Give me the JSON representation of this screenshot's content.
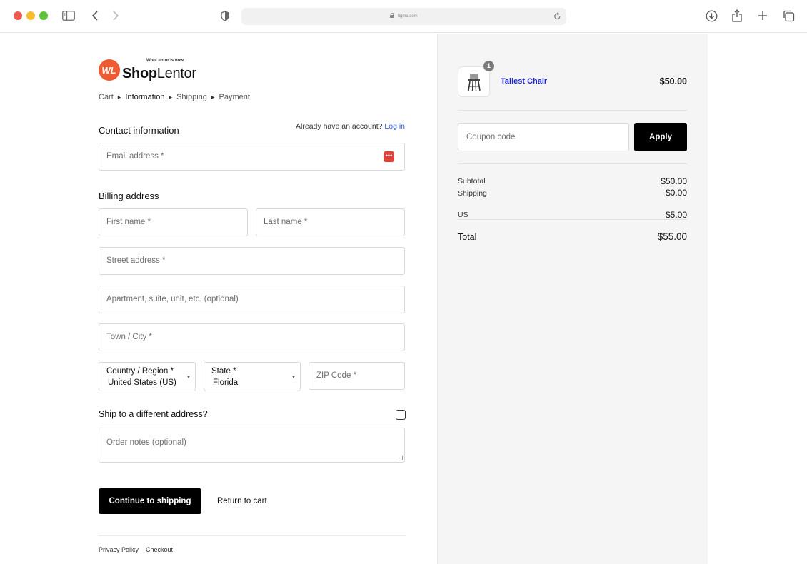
{
  "browser": {
    "url": "figma.com",
    "icons": [
      "sidebar-icon",
      "back-icon",
      "forward-icon",
      "shield-icon",
      "lock-icon",
      "reload-icon",
      "download-icon",
      "share-icon",
      "new-tab-icon",
      "tabs-overview-icon"
    ]
  },
  "brand": {
    "tagline": "WooLentor is now",
    "name_bold": "Shop",
    "name_regular": "Lentor",
    "mark_text": "WL",
    "mark_color": "#ee5a31"
  },
  "breadcrumb": [
    "Cart",
    "Information",
    "Shipping",
    "Payment"
  ],
  "contact": {
    "title": "Contact information",
    "account_prompt": "Already have an account?",
    "login_link": "Log in",
    "email_placeholder": "Email address *"
  },
  "billing": {
    "title": "Billing address",
    "first_name": "First name *",
    "last_name": "Last name *",
    "street": "Street address *",
    "apartment": "Apartment, suite, unit, etc. (optional)",
    "city": "Town / City *",
    "country_label": "Country / Region *",
    "country_value": "United States (US)",
    "state_label": "State *",
    "state_value": "Florida",
    "zip": "ZIP Code *"
  },
  "ship_different": {
    "label": "Ship to a different address?",
    "checked": false
  },
  "order_notes": "Order notes (optional)",
  "actions": {
    "continue": "Continue to shipping",
    "return": "Return to cart"
  },
  "footer": [
    "Privacy Policy",
    "Checkout"
  ],
  "order": {
    "item": {
      "name": "Tallest Chair",
      "price": "$50.00",
      "quantity": "1"
    },
    "coupon_placeholder": "Coupon code",
    "apply": "Apply",
    "subtotal_label": "Subtotal",
    "subtotal_value": "$50.00",
    "shipping_label": "Shipping",
    "shipping_value": "$0.00",
    "tax_label": "US",
    "tax_value": "$5.00",
    "total_label": "Total",
    "total_value": "$55.00"
  },
  "colors": {
    "link": "#2a5bd7",
    "product_link": "#1c25d6",
    "button": "#000000"
  }
}
